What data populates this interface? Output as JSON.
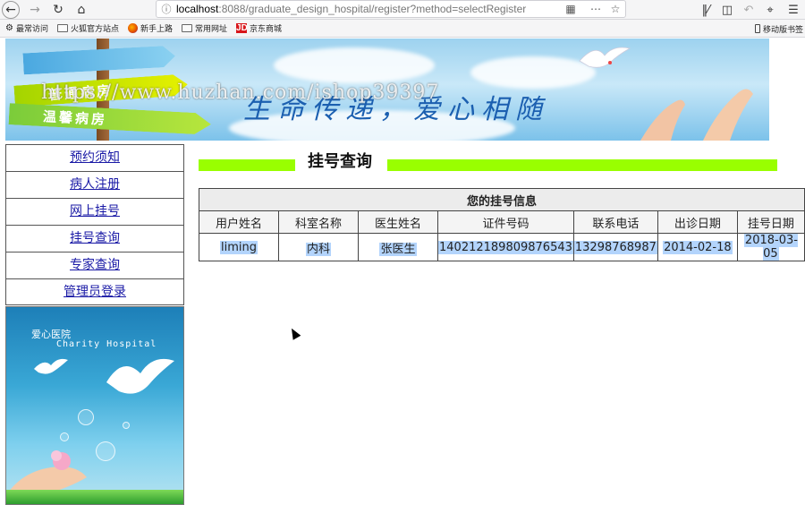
{
  "browser": {
    "url_host": "localhost",
    "url_rest": ":8088/graduate_design_hospital/register?method=selectRegister",
    "bookmarks": [
      "最常访问",
      "火狐官方站点",
      "新手上路",
      "常用网址",
      "京东商城"
    ],
    "bookmark_right": "移动版书签"
  },
  "banner": {
    "watermark": "https://www.huzhan.com/ishop39397",
    "slogan": "生命传递，爱心相随",
    "signs": [
      "普通病房",
      "温馨病房"
    ]
  },
  "sidebar": {
    "items": [
      {
        "label": "预约须知"
      },
      {
        "label": "病人注册"
      },
      {
        "label": "网上挂号"
      },
      {
        "label": "挂号查询"
      },
      {
        "label": "专家查询"
      },
      {
        "label": "管理员登录"
      }
    ],
    "promo": {
      "name_cn": "爱心医院",
      "name_en": "Charity Hospital"
    }
  },
  "main": {
    "title": "挂号查询",
    "table": {
      "caption": "您的挂号信息",
      "headers": [
        "用户姓名",
        "科室名称",
        "医生姓名",
        "证件号码",
        "联系电话",
        "出诊日期",
        "挂号日期"
      ],
      "rows": [
        [
          "liming",
          "内科",
          "张医生",
          "140212189809876543",
          "13298768987",
          "2014-02-18",
          "2018-03-05"
        ]
      ]
    }
  },
  "colors": {
    "accent_bar": "#99ff00",
    "link": "#1a1aa6",
    "selection": "#b3d4fc"
  }
}
